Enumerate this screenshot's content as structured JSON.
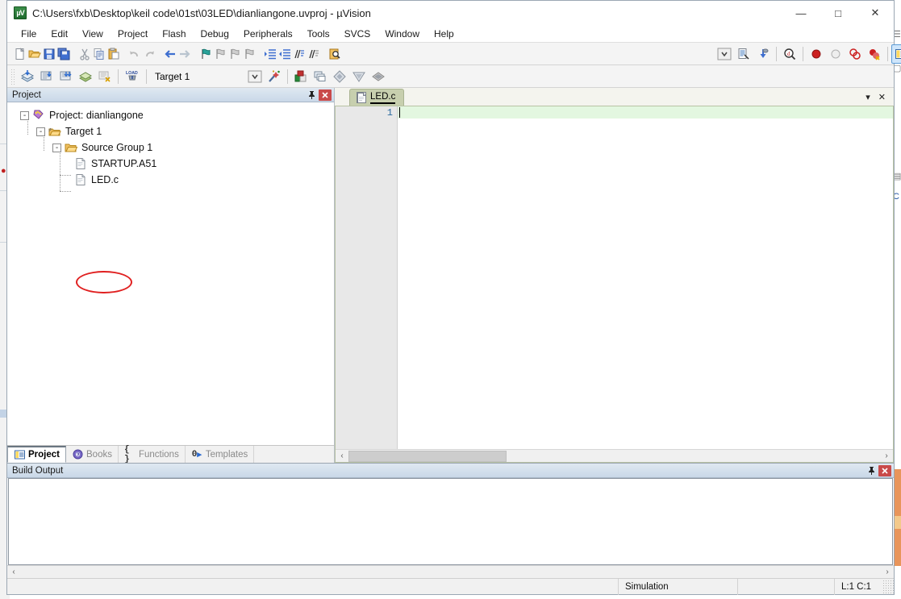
{
  "window": {
    "title": "C:\\Users\\fxb\\Desktop\\keil code\\01st\\03LED\\dianliangone.uvproj - µVision",
    "app_icon": "uvision-icon",
    "minimize": "—",
    "maximize": "□",
    "close": "✕"
  },
  "menubar": {
    "items": [
      {
        "label": "File"
      },
      {
        "label": "Edit"
      },
      {
        "label": "View"
      },
      {
        "label": "Project"
      },
      {
        "label": "Flash"
      },
      {
        "label": "Debug"
      },
      {
        "label": "Peripherals"
      },
      {
        "label": "Tools"
      },
      {
        "label": "SVCS"
      },
      {
        "label": "Window"
      },
      {
        "label": "Help"
      }
    ]
  },
  "toolbar_file": {
    "buttons": [
      {
        "name": "new-file-icon",
        "glyph": "🗋"
      },
      {
        "name": "open-file-icon",
        "glyph": "📂"
      },
      {
        "name": "save-icon",
        "glyph": "💾"
      },
      {
        "name": "save-all-icon",
        "glyph": "🖫"
      },
      {
        "name": "cut-icon",
        "glyph": "✂"
      },
      {
        "name": "copy-icon",
        "glyph": "❐"
      },
      {
        "name": "paste-icon",
        "glyph": "📋"
      },
      {
        "name": "undo-icon",
        "glyph": "↶"
      },
      {
        "name": "redo-icon",
        "glyph": "↷"
      },
      {
        "name": "navigate-back-icon",
        "glyph": "←"
      },
      {
        "name": "navigate-forward-icon",
        "glyph": "→"
      },
      {
        "name": "bookmark-toggle-icon",
        "glyph": "⚑"
      },
      {
        "name": "bookmark-prev-icon",
        "glyph": "⚑"
      },
      {
        "name": "bookmark-next-icon",
        "glyph": "⚑"
      },
      {
        "name": "bookmark-clear-icon",
        "glyph": "⚑"
      },
      {
        "name": "indent-increase-icon",
        "glyph": "≡"
      },
      {
        "name": "indent-decrease-icon",
        "glyph": "≡"
      },
      {
        "name": "comment-icon",
        "glyph": "//"
      },
      {
        "name": "uncomment-icon",
        "glyph": "//"
      },
      {
        "name": "find-in-files-icon",
        "glyph": "🔍"
      }
    ]
  },
  "toolbar_right": {
    "buttons": [
      {
        "name": "target-dropdown-icon",
        "glyph": "⌄"
      },
      {
        "name": "configure-icon",
        "glyph": "🗎"
      },
      {
        "name": "debug-session-icon",
        "glyph": "🖊"
      },
      {
        "name": "find-icon",
        "glyph": "🔎"
      },
      {
        "name": "breakpoint-insert-icon",
        "glyph": "●"
      },
      {
        "name": "breakpoint-disable-icon",
        "glyph": "○"
      },
      {
        "name": "breakpoint-kill-all-icon",
        "glyph": "◎"
      },
      {
        "name": "breakpoint-disable-all-icon",
        "glyph": "●"
      },
      {
        "name": "project-window-icon",
        "glyph": "▤",
        "active": true
      },
      {
        "name": "project-window-dropdown-icon",
        "glyph": "▾"
      },
      {
        "name": "configuration-wizard-icon",
        "glyph": "🔧"
      }
    ]
  },
  "toolbar_build": {
    "buttons": [
      {
        "name": "translate-icon",
        "glyph": "◈"
      },
      {
        "name": "build-target-icon",
        "glyph": "▦"
      },
      {
        "name": "rebuild-all-icon",
        "glyph": "▦"
      },
      {
        "name": "batch-build-icon",
        "glyph": "▤"
      },
      {
        "name": "stop-build-icon",
        "glyph": "▧"
      },
      {
        "name": "download-icon",
        "glyph": "LOAD"
      }
    ],
    "target_label": "Target 1",
    "after_buttons": [
      {
        "name": "target-select-arrow-icon",
        "glyph": "⌄"
      },
      {
        "name": "options-for-target-icon",
        "glyph": "🪄"
      },
      {
        "name": "manage-project-items-icon",
        "glyph": "▣"
      },
      {
        "name": "manage-multi-project-icon",
        "glyph": "❐"
      },
      {
        "name": "components-icon",
        "glyph": "◆"
      },
      {
        "name": "pack-installer-icon",
        "glyph": "▽"
      },
      {
        "name": "manage-runtime-icon",
        "glyph": "◈"
      }
    ]
  },
  "project_panel": {
    "title": "Project",
    "pin_glyph": "📌",
    "close_glyph": "✕",
    "tree": [
      {
        "label": "Project: dianliangone",
        "icon": "project-icon",
        "depth": 0,
        "expander": "-"
      },
      {
        "label": "Target 1",
        "icon": "target-icon",
        "depth": 1,
        "expander": "-"
      },
      {
        "label": "Source Group 1",
        "icon": "folder-icon",
        "depth": 2,
        "expander": "-"
      },
      {
        "label": "STARTUP.A51",
        "icon": "file-icon",
        "depth": 3,
        "expander": ""
      },
      {
        "label": "LED.c",
        "icon": "file-icon",
        "depth": 3,
        "expander": "",
        "annotated": true
      }
    ],
    "tabs": [
      {
        "label": "Project",
        "icon": "project-tab-icon",
        "selected": true
      },
      {
        "label": "Books",
        "icon": "books-tab-icon",
        "selected": false
      },
      {
        "label": "Functions",
        "icon": "functions-tab-icon",
        "selected": false
      },
      {
        "label": "Templates",
        "icon": "templates-tab-icon",
        "selected": false
      }
    ],
    "annotation": {
      "shape": "ellipse",
      "color": "#e02020",
      "target": "LED.c"
    }
  },
  "editor": {
    "tabs": [
      {
        "label": "LED.c",
        "icon": "source-file-icon",
        "active": true
      }
    ],
    "tab_dropdown_glyph": "▾",
    "tab_close_glyph": "✕",
    "line_numbers": [
      "1"
    ],
    "lines": [
      ""
    ],
    "active_line": 1,
    "scroll_left_glyph": "‹",
    "scroll_right_glyph": "›"
  },
  "build_output": {
    "title": "Build Output",
    "pin_glyph": "📌",
    "close_glyph": "✕",
    "content": "",
    "scroll_left_glyph": "‹",
    "scroll_right_glyph": "›"
  },
  "statusbar": {
    "message": "",
    "simulation": "Simulation",
    "spacer": "",
    "cursor_position": "L:1 C:1"
  },
  "colors": {
    "tab_active_bg": "#c7cfae",
    "active_line_bg": "#e3f7e0",
    "panel_header_bg": "#c9d8e8",
    "annotation_red": "#e02020",
    "close_button_red": "#c94a4a",
    "line_number_fg": "#2b6a9e"
  }
}
